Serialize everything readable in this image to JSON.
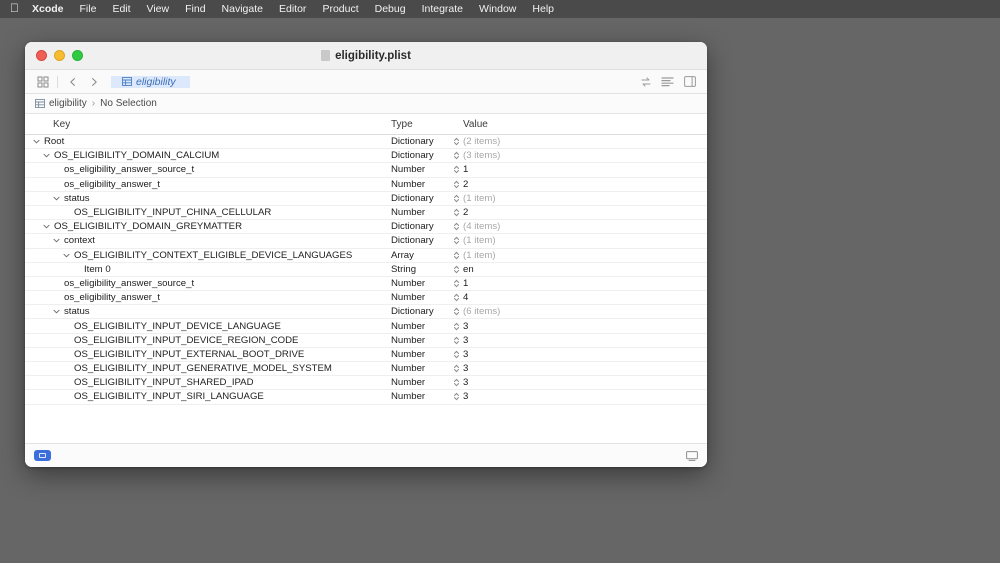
{
  "menubar": {
    "apple_icon": "apple-icon",
    "items": [
      {
        "label": "Xcode",
        "bold": true
      },
      {
        "label": "File",
        "bold": false
      },
      {
        "label": "Edit",
        "bold": false
      },
      {
        "label": "View",
        "bold": false
      },
      {
        "label": "Find",
        "bold": false
      },
      {
        "label": "Navigate",
        "bold": false
      },
      {
        "label": "Editor",
        "bold": false
      },
      {
        "label": "Product",
        "bold": false
      },
      {
        "label": "Debug",
        "bold": false
      },
      {
        "label": "Integrate",
        "bold": false
      },
      {
        "label": "Window",
        "bold": false
      },
      {
        "label": "Help",
        "bold": false
      }
    ]
  },
  "window": {
    "title": "eligibility.plist",
    "title_icon": "document-icon",
    "traffic_lights": [
      "close",
      "minimize",
      "zoom"
    ]
  },
  "toolbar": {
    "navigator_toggle_icon": "grid-icon",
    "back_icon": "chevron-left-icon",
    "forward_icon": "chevron-right-icon",
    "tab": {
      "label": "eligibility",
      "icon": "table-icon"
    },
    "right_icons": [
      "swap-arrows-icon",
      "lines-list-icon",
      "inspector-panel-icon"
    ]
  },
  "breadcrumb": {
    "icon": "table-icon",
    "root": "eligibility",
    "separator": "›",
    "selection": "No Selection"
  },
  "table": {
    "columns": [
      "Key",
      "Type",
      "Value"
    ],
    "rows": [
      {
        "indent": 0,
        "twisty": "open",
        "key": "Root",
        "type": "Dictionary",
        "value": "(2 items)",
        "muted": true
      },
      {
        "indent": 1,
        "twisty": "open",
        "key": "OS_ELIGIBILITY_DOMAIN_CALCIUM",
        "type": "Dictionary",
        "value": "(3 items)",
        "muted": true
      },
      {
        "indent": 2,
        "twisty": "none",
        "key": "os_eligibility_answer_source_t",
        "type": "Number",
        "value": "1",
        "muted": false
      },
      {
        "indent": 2,
        "twisty": "none",
        "key": "os_eligibility_answer_t",
        "type": "Number",
        "value": "2",
        "muted": false
      },
      {
        "indent": 2,
        "twisty": "open",
        "key": "status",
        "type": "Dictionary",
        "value": "(1 item)",
        "muted": true
      },
      {
        "indent": 3,
        "twisty": "none",
        "key": "OS_ELIGIBILITY_INPUT_CHINA_CELLULAR",
        "type": "Number",
        "value": "2",
        "muted": false
      },
      {
        "indent": 1,
        "twisty": "open",
        "key": "OS_ELIGIBILITY_DOMAIN_GREYMATTER",
        "type": "Dictionary",
        "value": "(4 items)",
        "muted": true
      },
      {
        "indent": 2,
        "twisty": "open",
        "key": "context",
        "type": "Dictionary",
        "value": "(1 item)",
        "muted": true
      },
      {
        "indent": 3,
        "twisty": "open",
        "key": "OS_ELIGIBILITY_CONTEXT_ELIGIBLE_DEVICE_LANGUAGES",
        "type": "Array",
        "value": "(1 item)",
        "muted": true
      },
      {
        "indent": 4,
        "twisty": "none",
        "key": "Item 0",
        "type": "String",
        "value": "en",
        "muted": false
      },
      {
        "indent": 2,
        "twisty": "none",
        "key": "os_eligibility_answer_source_t",
        "type": "Number",
        "value": "1",
        "muted": false
      },
      {
        "indent": 2,
        "twisty": "none",
        "key": "os_eligibility_answer_t",
        "type": "Number",
        "value": "4",
        "muted": false
      },
      {
        "indent": 2,
        "twisty": "open",
        "key": "status",
        "type": "Dictionary",
        "value": "(6 items)",
        "muted": true
      },
      {
        "indent": 3,
        "twisty": "none",
        "key": "OS_ELIGIBILITY_INPUT_DEVICE_LANGUAGE",
        "type": "Number",
        "value": "3",
        "muted": false
      },
      {
        "indent": 3,
        "twisty": "none",
        "key": "OS_ELIGIBILITY_INPUT_DEVICE_REGION_CODE",
        "type": "Number",
        "value": "3",
        "muted": false
      },
      {
        "indent": 3,
        "twisty": "none",
        "key": "OS_ELIGIBILITY_INPUT_EXTERNAL_BOOT_DRIVE",
        "type": "Number",
        "value": "3",
        "muted": false
      },
      {
        "indent": 3,
        "twisty": "none",
        "key": "OS_ELIGIBILITY_INPUT_GENERATIVE_MODEL_SYSTEM",
        "type": "Number",
        "value": "3",
        "muted": false
      },
      {
        "indent": 3,
        "twisty": "none",
        "key": "OS_ELIGIBILITY_INPUT_SHARED_IPAD",
        "type": "Number",
        "value": "3",
        "muted": false
      },
      {
        "indent": 3,
        "twisty": "none",
        "key": "OS_ELIGIBILITY_INPUT_SIRI_LANGUAGE",
        "type": "Number",
        "value": "3",
        "muted": false
      }
    ]
  },
  "statusbar": {
    "filter_toggle_icon": "filter-pill-icon",
    "console_icon": "console-icon"
  },
  "colors": {
    "desktop": "#666666",
    "menubar": "#4a4a4a",
    "tab_active_bg": "#dce8fb",
    "tab_active_text": "#3d6fb8",
    "accent": "#3b6ddb",
    "muted_text": "#a8a8a8"
  }
}
